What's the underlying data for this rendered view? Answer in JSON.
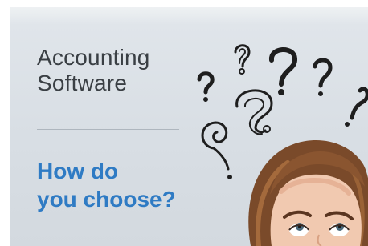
{
  "banner": {
    "title_line1": "Accounting",
    "title_line2": "Software",
    "question_line1": "How do",
    "question_line2": "you choose?"
  },
  "colors": {
    "background": "#d9dfe5",
    "title_text": "#3a3f44",
    "question_text": "#2f7bc4",
    "divider": "#aeb6be"
  },
  "icons": {
    "question_marks": "doodle-question-marks",
    "person": "woman-looking-up"
  }
}
